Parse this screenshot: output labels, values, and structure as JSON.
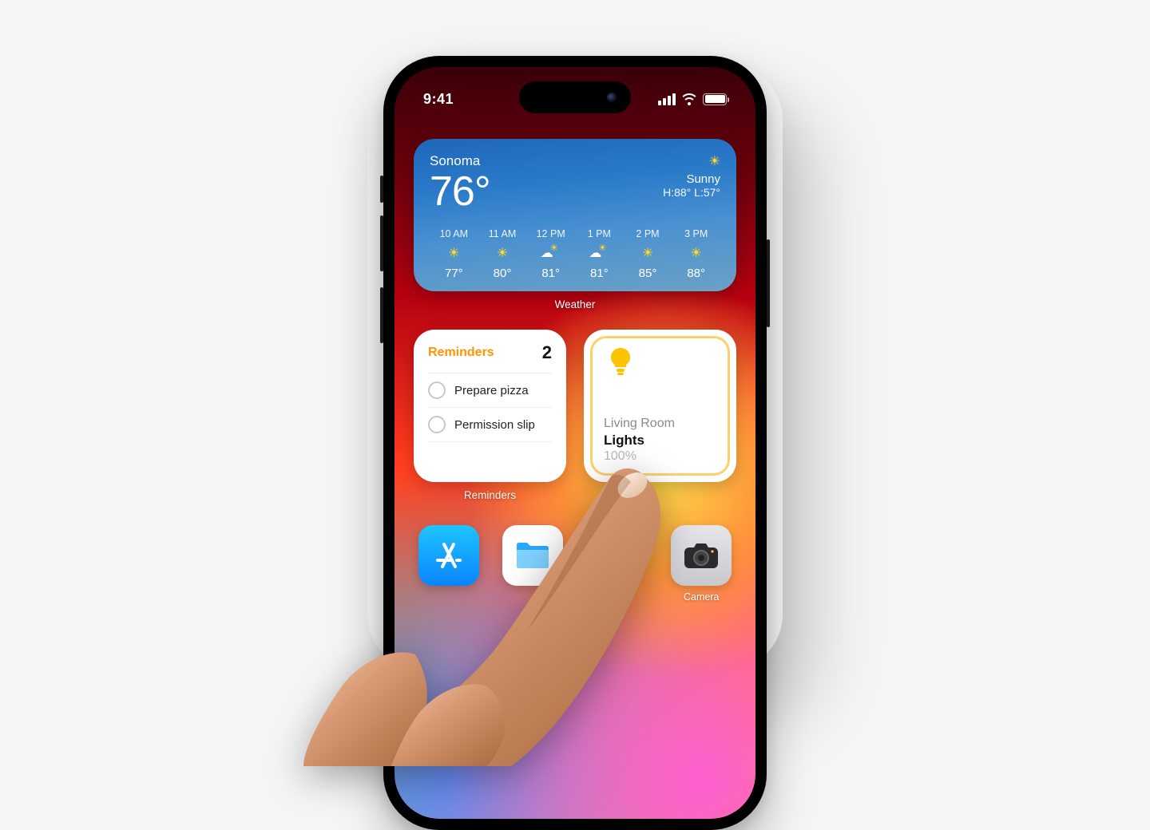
{
  "status": {
    "time": "9:41"
  },
  "weather": {
    "location": "Sonoma",
    "temp": "76°",
    "condition": "Sunny",
    "high_low": "H:88° L:57°",
    "label": "Weather",
    "hours": [
      {
        "t": "10 AM",
        "icon": "sun",
        "d": "77°"
      },
      {
        "t": "11 AM",
        "icon": "sun",
        "d": "80°"
      },
      {
        "t": "12 PM",
        "icon": "cloud-sun",
        "d": "81°"
      },
      {
        "t": "1 PM",
        "icon": "cloud-sun",
        "d": "81°"
      },
      {
        "t": "2 PM",
        "icon": "sun",
        "d": "85°"
      },
      {
        "t": "3 PM",
        "icon": "sun",
        "d": "88°"
      }
    ]
  },
  "reminders": {
    "title": "Reminders",
    "count": "2",
    "items": [
      {
        "text": "Prepare pizza"
      },
      {
        "text": "Permission slip"
      }
    ],
    "label": "Reminders"
  },
  "home": {
    "room": "Living Room",
    "name": "Lights",
    "pct": "100%"
  },
  "apps": {
    "camera_label": "Camera"
  }
}
